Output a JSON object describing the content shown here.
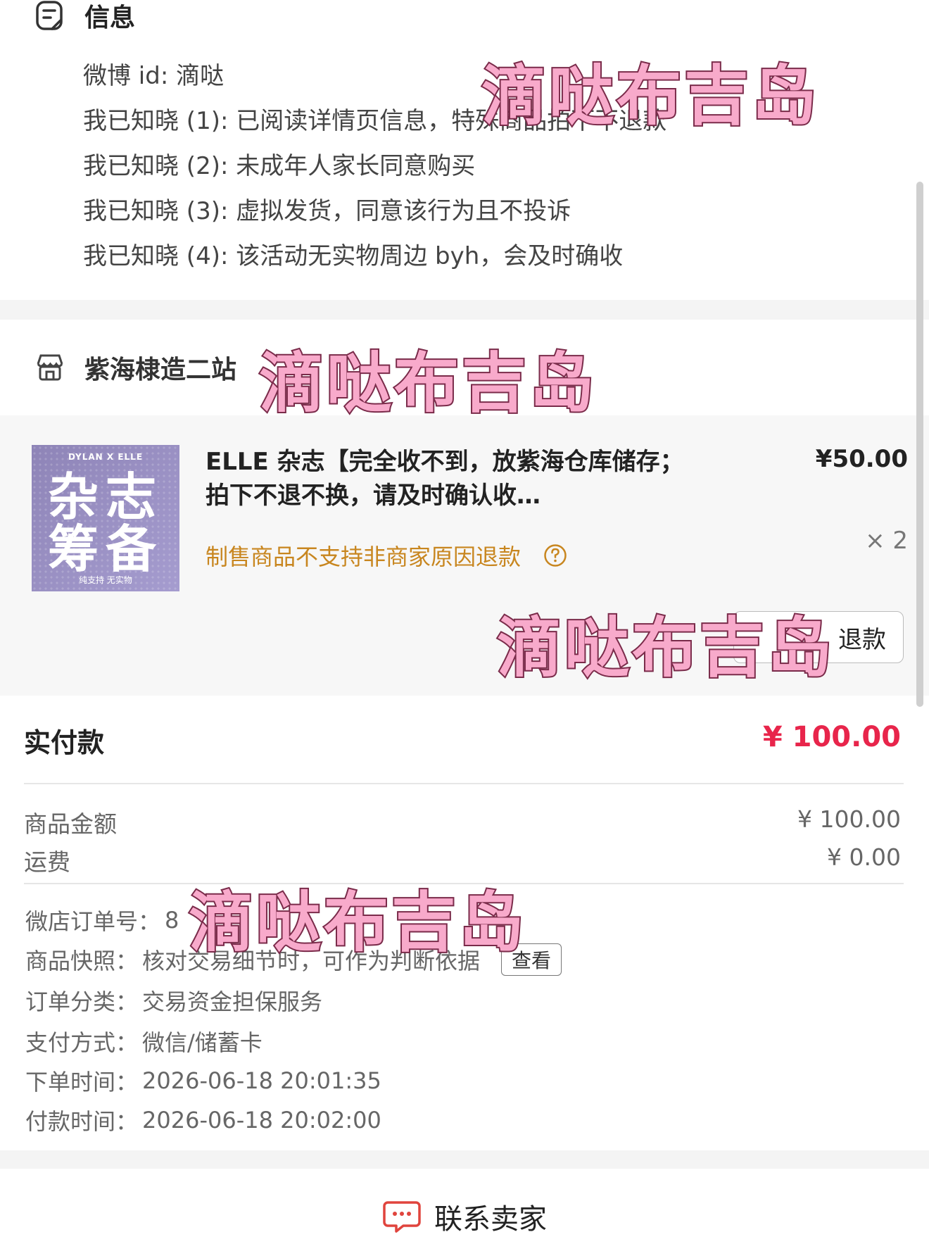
{
  "info": {
    "title": "信息",
    "lines": [
      "微博 id: 滴哒",
      "我已知晓 (1): 已阅读详情页信息，特殊商品拍下不退款",
      "我已知晓 (2): 未成年人家长同意购买",
      "我已知晓 (3): 虚拟发货，同意该行为且不投诉",
      "我已知晓 (4): 该活动无实物周边 byh，会及时确收"
    ]
  },
  "shop": {
    "name": "紫海棣造二站"
  },
  "product": {
    "thumb_top": "DYLAN X ELLE",
    "thumb_line1": "杂志",
    "thumb_line2": "筹备",
    "thumb_bottom": "纯支持 无实物",
    "title": "ELLE 杂志【完全收不到，放紫海仓库储存；拍下不退不换，请及时确认收…",
    "price": "¥50.00",
    "qty": "× 2",
    "note": "制售商品不支持非商家原因退款",
    "refund_label": "退款"
  },
  "payment": {
    "paid_label": "实付款",
    "paid_value": "¥ 100.00",
    "goods_label": "商品金额",
    "goods_value": "¥ 100.00",
    "shipping_label": "运费",
    "shipping_value": "¥ 0.00"
  },
  "details": {
    "order_no_label": "微店订单号：",
    "order_no_value": "8",
    "snapshot_label": "商品快照：",
    "snapshot_value": "核对交易细节时，可作为判断依据",
    "snapshot_button": "查看",
    "category_label": "订单分类：",
    "category_value": "交易资金担保服务",
    "paymethod_label": "支付方式：",
    "paymethod_value": "微信/储蓄卡",
    "order_time_label": "下单时间：",
    "order_time_value": "2026-06-18 20:01:35",
    "pay_time_label": "付款时间：",
    "pay_time_value": "2026-06-18 20:02:00"
  },
  "contact": {
    "label": "联系卖家"
  },
  "watermark": {
    "text": "滴哒布吉岛"
  },
  "colors": {
    "accent_red": "#e8254b",
    "note_orange": "#c8861f",
    "watermark_pink": "#f8aacb"
  },
  "icons": [
    "note-icon",
    "store-icon",
    "help-icon",
    "chat-icon"
  ]
}
